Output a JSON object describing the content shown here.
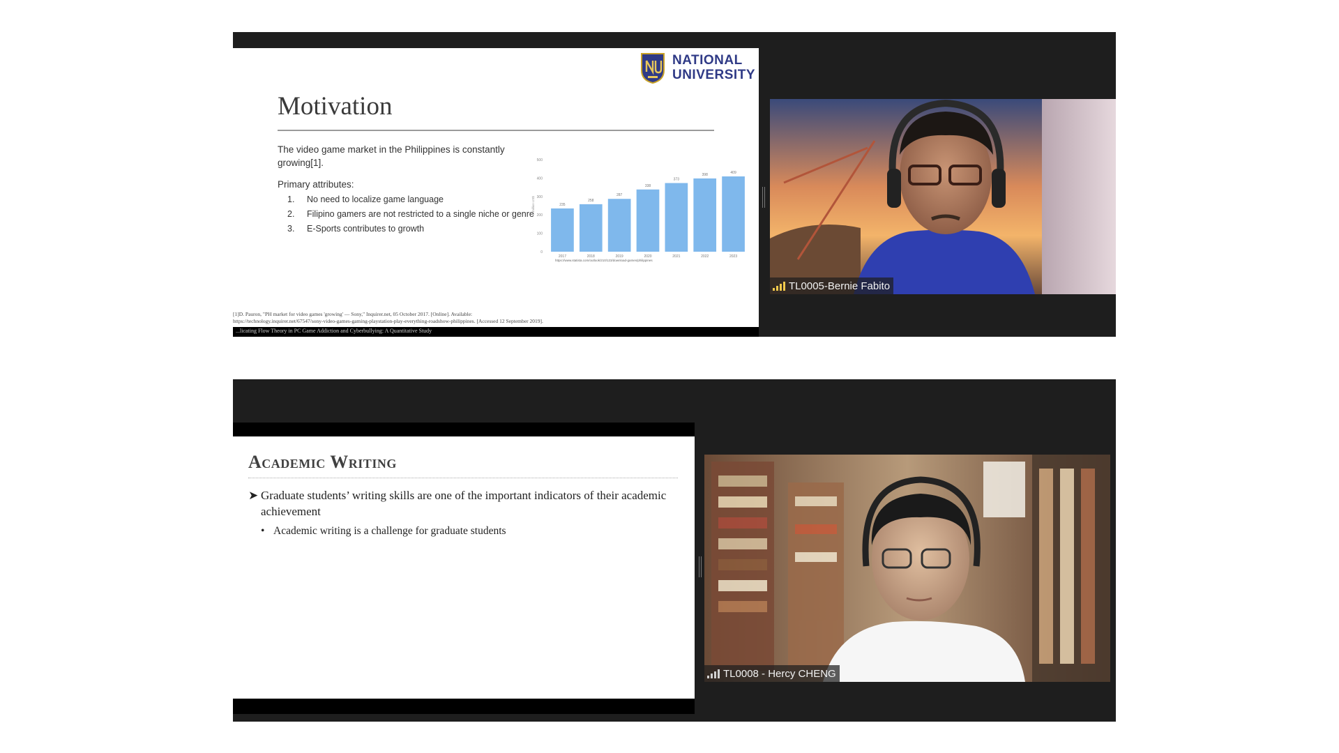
{
  "top_panel": {
    "slide": {
      "logo_text": "NATIONAL UNIVERSITY",
      "logo_line1": "NATIONAL",
      "logo_line2": "UNIVERSITY",
      "title": "Motivation",
      "intro": "The video game market in the Philippines is constantly growing[1].",
      "primary_label": "Primary attributes:",
      "attributes": [
        {
          "num": "1.",
          "text": "No need to localize game language"
        },
        {
          "num": "2.",
          "text": "Filipino gamers are not restricted to  a single niche or genre"
        },
        {
          "num": "3.",
          "text": "E-Sports contributes to growth"
        }
      ],
      "footnote_line1": "[1]D. Pauron, \"PH market for video games 'growing' — Sony,\" Inquirer.net, 05 October 2017. [Online]. Available:",
      "footnote_line2": "https://technology.inquirer.net/67547/sony-video-games-gaming-playstation-play-everything-roadshow-philippines. [Accessed 12 September 2019].",
      "bottom_strip_text": "...licating Flow Theory in PC Game Addiction and Cyberbullying: A Quantitative Study"
    },
    "participant": {
      "name": "TL0005-Bernie Fabito"
    }
  },
  "chart_data": {
    "type": "bar",
    "categories": [
      "2017",
      "2018",
      "2019",
      "2020",
      "2021",
      "2022",
      "2023"
    ],
    "values": [
      235,
      258,
      287,
      338,
      373,
      398,
      409
    ],
    "ylabel": "in million US$",
    "ylim": [
      0,
      500
    ],
    "yticks": [
      0,
      100,
      200,
      300,
      400,
      500
    ],
    "source": "https://www.statista.com/outlook/210/123/download-games/philippines",
    "bar_color": "#7fb8ec",
    "grid": false
  },
  "bottom_panel": {
    "slide": {
      "title": "Academic Writing",
      "bullet": "Graduate students’ writing skills are one of the important indicators of their academic achievement",
      "bullet_mark": "➤",
      "sub_bullet": "Academic writing is a challenge for graduate students",
      "sub_mark": "•"
    },
    "participant": {
      "name": "TL0008 - Hercy CHENG"
    }
  },
  "colors": {
    "panel_bg": "#1e1e1e",
    "signal_active": "#f2c94c",
    "logo_blue": "#2f3a86"
  }
}
